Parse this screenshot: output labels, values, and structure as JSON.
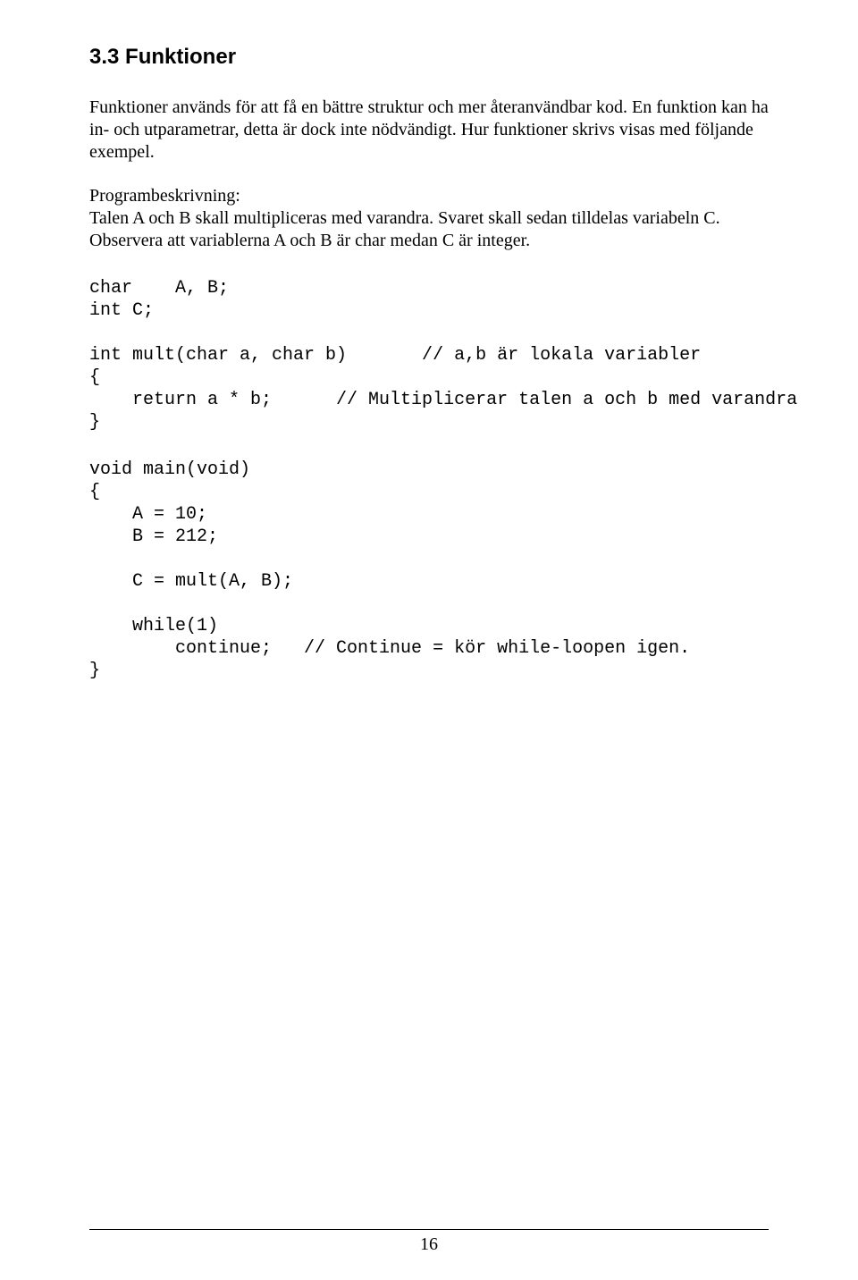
{
  "heading": "3.3 Funktioner",
  "para1": "Funktioner används för att få en bättre struktur och mer återanvändbar kod. En funktion kan ha in- och utparametrar, detta är dock inte nödvändigt. Hur funktioner skrivs visas med följande exempel.",
  "para2_line1": "Programbeskrivning:",
  "para2_line2": "Talen A och B skall multipliceras med varandra. Svaret skall sedan tilldelas variabeln C. Observera att variablerna A och B är char medan C är integer.",
  "code1": "char    A, B;\nint C;\n\nint mult(char a, char b)       // a,b är lokala variabler\n{\n    return a * b;      // Multiplicerar talen a och b med varandra\n}",
  "code2": "void main(void)\n{\n    A = 10;\n    B = 212;\n\n    C = mult(A, B);\n\n    while(1)\n        continue;   // Continue = kör while-loopen igen.\n}",
  "page_number": "16"
}
